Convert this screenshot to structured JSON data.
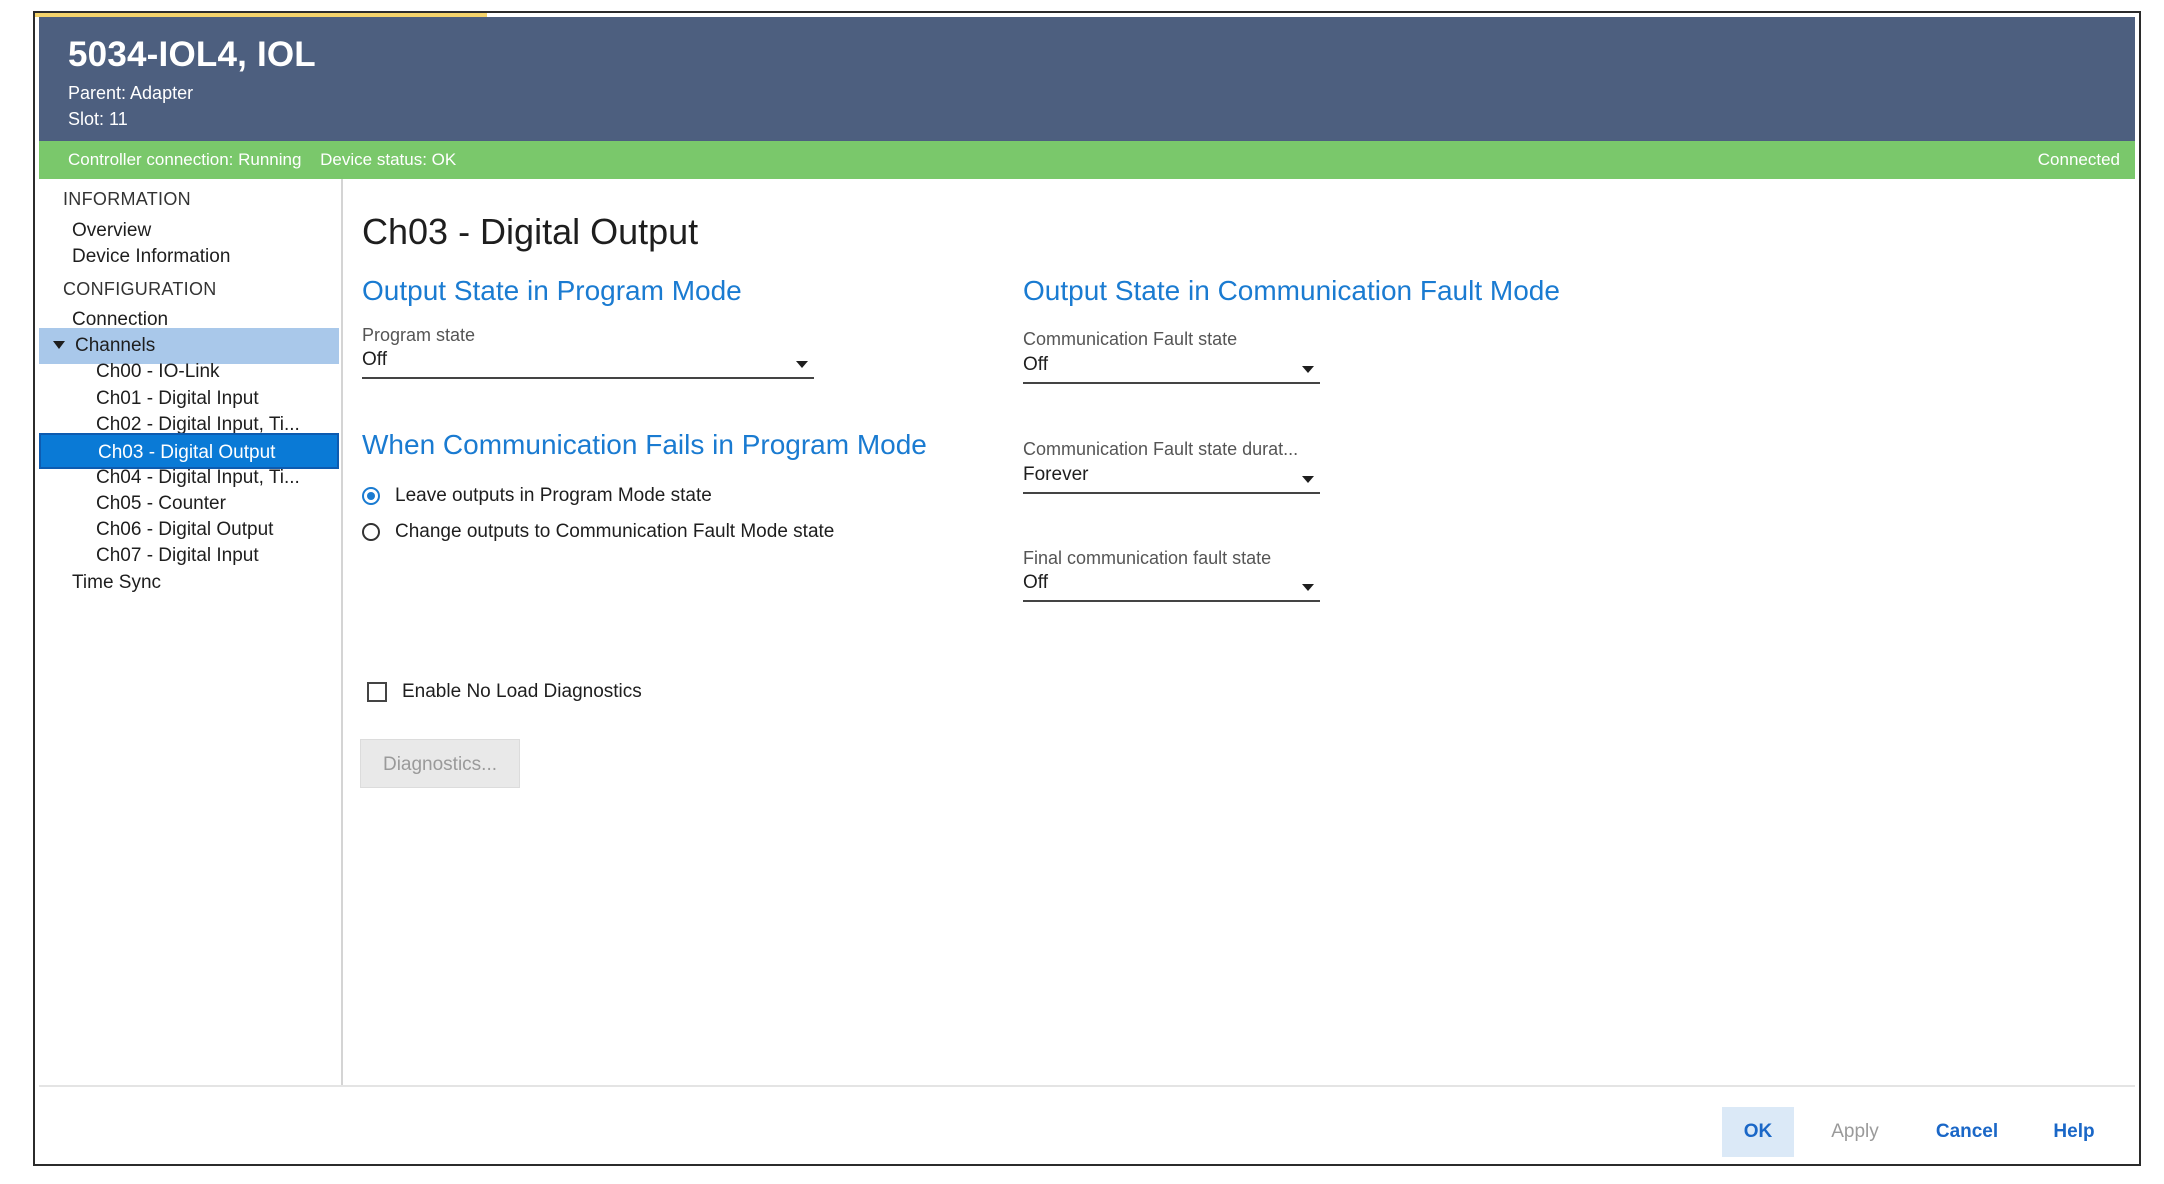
{
  "header": {
    "title": "5034-IOL4, IOL",
    "parent": "Parent:  Adapter",
    "slot": "Slot:  11"
  },
  "status_bar": {
    "controller_connection": "Controller connection: Running",
    "device_status": "Device status: OK",
    "connection_state": "Connected",
    "color": "#7ac86b"
  },
  "sidebar": {
    "information_heading": "INFORMATION",
    "overview": "Overview",
    "device_information": "Device Information",
    "configuration_heading": "CONFIGURATION",
    "connection": "Connection",
    "channels": "Channels",
    "channel_items": [
      "Ch00 - IO-Link",
      "Ch01 - Digital Input",
      "Ch02 - Digital Input, Ti...",
      "Ch03 - Digital Output",
      "Ch04 - Digital Input, Ti...",
      "Ch05 - Counter",
      "Ch06 - Digital Output",
      "Ch07 - Digital Input"
    ],
    "selected_channel": "Ch03 - Digital Output",
    "time_sync": "Time Sync"
  },
  "main": {
    "page_title": "Ch03 - Digital Output",
    "program_mode_section": "Output State in Program Mode",
    "program_state_label": "Program state",
    "program_state_value": "Off",
    "comm_fails_section": "When Communication Fails in Program Mode",
    "radio_leave": "Leave outputs in Program Mode state",
    "radio_change": "Change outputs to Communication Fault Mode state",
    "radio_selected": "Leave outputs in Program Mode state",
    "comm_fault_section": "Output State in Communication Fault Mode",
    "comm_fault_state_label": "Communication Fault state",
    "comm_fault_state_value": "Off",
    "comm_fault_duration_label": "Communication Fault state durat...",
    "comm_fault_duration_value": "Forever",
    "final_fault_state_label": "Final communication fault state",
    "final_fault_state_value": "Off",
    "no_load_diag_label": "Enable No Load Diagnostics",
    "no_load_diag_checked": false,
    "diagnostics_button": "Diagnostics..."
  },
  "footer": {
    "ok": "OK",
    "apply": "Apply",
    "cancel": "Cancel",
    "help": "Help"
  },
  "colors": {
    "header_bg": "#4d5f7f",
    "accent_blue": "#1a7bd1",
    "selected_bg": "#0a7ad6",
    "expanded_bg": "#a9c8ea"
  }
}
